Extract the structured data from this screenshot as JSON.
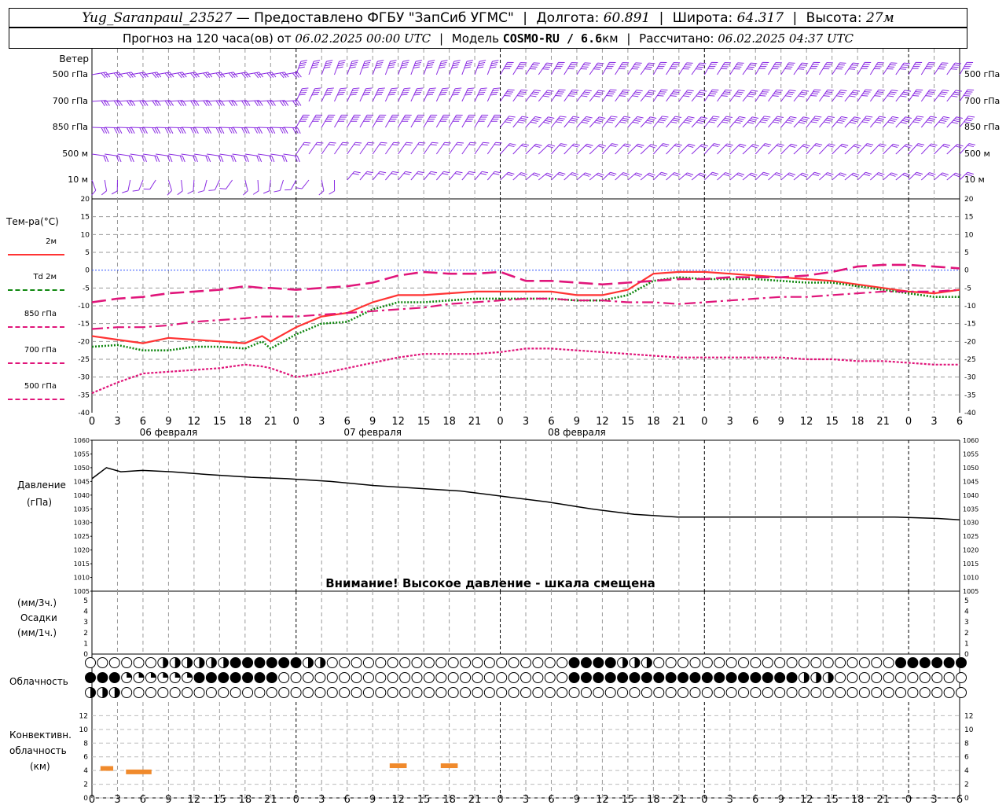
{
  "header": {
    "station": "Yug_Saranpaul_23527",
    "dash": "—",
    "provider": "Предоставлено ФГБУ \"ЗапСиб УГМС\"",
    "lon_label": "Долгота:",
    "lon_value": "60.891",
    "lat_label": "Широта:",
    "lat_value": "64.317",
    "alt_label": "Высота:",
    "alt_value": "27м",
    "forecast_label": "Прогноз на 120 часа(ов) от",
    "forecast_start": "06.02.2025 00:00 UTC",
    "model_label": "Модель",
    "model_name": "COSMO-RU / 6.6",
    "model_unit": "км",
    "calc_label": "Рассчитано:",
    "calc_time": "06.02.2025 04:37 UTC"
  },
  "wind_panel": {
    "title": "Ветер",
    "levels": [
      "500 гПа",
      "700 гПа",
      "850 гПа",
      "500 м",
      "10  м"
    ]
  },
  "temp_panel": {
    "title": "Тем-ра(°C)",
    "legend": [
      {
        "label": "2м",
        "color": "#ff3333",
        "style": "solid"
      },
      {
        "label": "Td  2м",
        "color": "#118811",
        "style": "dotted"
      },
      {
        "label": "850 гПа",
        "color": "#e0157a",
        "style": "dashdot"
      },
      {
        "label": "700 гПа",
        "color": "#e0157a",
        "style": "longdash"
      },
      {
        "label": "500 гПа",
        "color": "#e0157a",
        "style": "dash"
      }
    ]
  },
  "pressure_panel": {
    "title": "Давление",
    "unit": "(гПа)",
    "warning": "Внимание! Высокое давление - шкала смещена"
  },
  "precip_panel": {
    "unit_top": "(мм/3ч.)",
    "title": "Осадки",
    "unit_bottom": "(мм/1ч.)"
  },
  "cloud_panel": {
    "title": "Облачность"
  },
  "conv_panel": {
    "title_1": "Конвективн.",
    "title_2": "облачность",
    "unit": "(км)"
  },
  "day_labels": [
    "06 февраля",
    "07 февраля",
    "08 февраля"
  ],
  "hour_ticks": [
    "0",
    "3",
    "6",
    "9",
    "12",
    "15",
    "18",
    "21",
    "0",
    "3",
    "6",
    "9",
    "12",
    "15",
    "18",
    "21",
    "0",
    "3",
    "6",
    "9",
    "12",
    "15",
    "18",
    "21",
    "0",
    "3",
    "6"
  ],
  "chart_data": [
    {
      "type": "line",
      "name": "temperature",
      "x": [
        0,
        3,
        6,
        9,
        12,
        15,
        18,
        20,
        21,
        24,
        27,
        30,
        33,
        36,
        39,
        42,
        45,
        48,
        51,
        54,
        57,
        60,
        63,
        66,
        69,
        72,
        75,
        78,
        81,
        84,
        87,
        90,
        93,
        96,
        99,
        102
      ],
      "ylim": [
        -40,
        20
      ],
      "yticks": [
        20,
        15,
        10,
        5,
        0,
        -5,
        -10,
        -15,
        -20,
        -25,
        -30,
        -35,
        -40
      ],
      "series": [
        {
          "name": "2м",
          "values": [
            -18.5,
            -19.5,
            -20.5,
            -19,
            -19.5,
            -20,
            -20.5,
            -18.5,
            -20,
            -16,
            -13,
            -12,
            -9,
            -7,
            -7,
            -6.5,
            -6,
            -6,
            -6,
            -6,
            -7,
            -7,
            -5.5,
            -1,
            -0.5,
            -0.5,
            -1,
            -1.5,
            -2,
            -2.5,
            -3,
            -4,
            -5,
            -6,
            -6.5,
            -5.5
          ]
        },
        {
          "name": "Td 2м",
          "values": [
            -21.5,
            -21,
            -22.5,
            -22.5,
            -21.5,
            -21.5,
            -22,
            -20,
            -22,
            -18,
            -15,
            -14.5,
            -11,
            -9,
            -9,
            -8.5,
            -8,
            -8,
            -8,
            -8,
            -8.5,
            -8.5,
            -7,
            -3,
            -2,
            -2.5,
            -2.5,
            -2.5,
            -3,
            -3.5,
            -3.5,
            -4.5,
            -5.5,
            -6.5,
            -7.5,
            -7.5
          ]
        },
        {
          "name": "850 гПа",
          "values": [
            -16.5,
            -16,
            -16,
            -15.5,
            -14.5,
            -14,
            -13.5,
            -13,
            -13,
            -13,
            -12.5,
            -12,
            -11.5,
            -11,
            -10.5,
            -9.5,
            -9,
            -8.5,
            -8,
            -8,
            -8.5,
            -8.5,
            -9,
            -9,
            -9.5,
            -9,
            -8.5,
            -8,
            -7.5,
            -7.5,
            -7,
            -6.5,
            -6,
            -6,
            -6,
            -5.5
          ]
        },
        {
          "name": "700 гПа",
          "values": [
            -9,
            -8,
            -7.5,
            -6.5,
            -6,
            -5.5,
            -4.5,
            -5,
            -5,
            -5.5,
            -5,
            -4.5,
            -3.5,
            -1.5,
            -0.5,
            -1,
            -1,
            -0.5,
            -3,
            -3,
            -3.5,
            -4,
            -3.5,
            -3,
            -2.5,
            -2.5,
            -2,
            -2,
            -2,
            -1.5,
            -0.5,
            1,
            1.5,
            1.5,
            1,
            0.5
          ]
        },
        {
          "name": "500 гПа",
          "values": [
            -34.5,
            -31.5,
            -29,
            -28.5,
            -28,
            -27.5,
            -26.5,
            -27,
            -27.5,
            -30,
            -29,
            -27.5,
            -26,
            -24.5,
            -23.5,
            -23.5,
            -23.5,
            -23,
            -22,
            -22,
            -22.5,
            -23,
            -23.5,
            -24,
            -24.5,
            -24.5,
            -24.5,
            -24.5,
            -24.5,
            -25,
            -25,
            -25.5,
            -25.5,
            -26,
            -26.5,
            -26.5
          ]
        }
      ]
    },
    {
      "type": "line",
      "name": "pressure",
      "x": [
        0,
        2,
        4,
        7,
        11,
        16,
        22,
        27,
        33,
        39,
        45,
        51,
        57,
        63,
        69,
        75,
        81,
        87,
        93,
        99,
        105,
        111,
        117,
        120
      ],
      "ylim": [
        1005,
        1060
      ],
      "yticks": [
        1060,
        1055,
        1050,
        1045,
        1040,
        1035,
        1030,
        1025,
        1020,
        1015,
        1010,
        1005
      ],
      "series": [
        {
          "name": "Давление",
          "values": [
            1046,
            1050,
            1048.5,
            1049,
            1048.5,
            1047.5,
            1046.5,
            1046,
            1045,
            1043.5,
            1042.5,
            1041.5,
            1039.5,
            1037.5,
            1035,
            1033,
            1032,
            1032,
            1032,
            1032,
            1032,
            1032,
            1031.5,
            1031
          ]
        }
      ]
    },
    {
      "type": "bar",
      "name": "precipitation",
      "ylim": [
        0,
        5
      ],
      "values": []
    },
    {
      "type": "bar",
      "name": "convective_cloud",
      "ylim": [
        0,
        13
      ],
      "segments": [
        {
          "x0": 1,
          "x1": 2.5,
          "value": 4.3
        },
        {
          "x0": 4,
          "x1": 7,
          "value": 3.8
        },
        {
          "x0": 35,
          "x1": 37,
          "value": 4.7
        },
        {
          "x0": 41,
          "x1": 43,
          "value": 4.7
        }
      ]
    }
  ]
}
